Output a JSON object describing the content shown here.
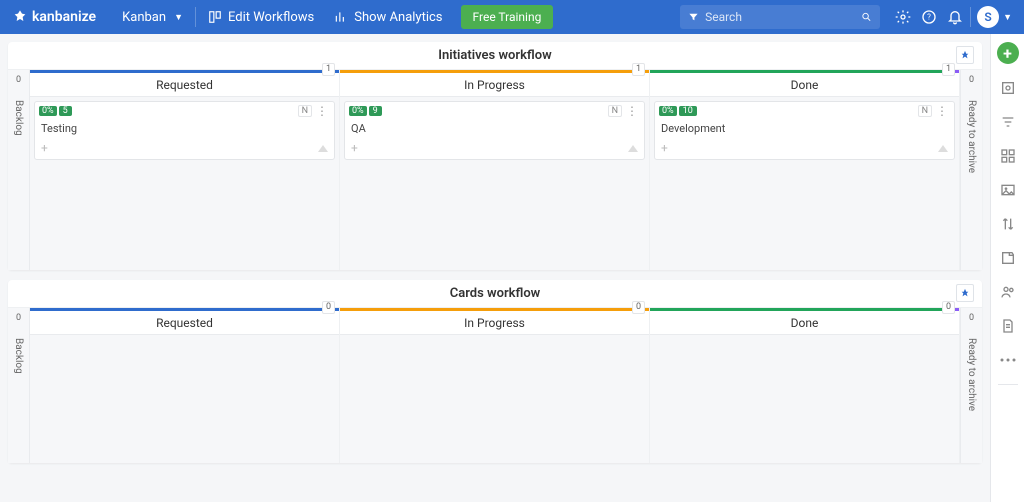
{
  "topbar": {
    "brand": "kanbanize",
    "board": "Kanban",
    "edit": "Edit Workflows",
    "analytics": "Show Analytics",
    "training": "Free Training",
    "search_placeholder": "Search",
    "avatar": "S"
  },
  "workflows": [
    {
      "title": "Initiatives workflow",
      "backlog": {
        "count": "0",
        "label": "Backlog"
      },
      "archive": {
        "count": "0",
        "label": "Ready to archive"
      },
      "columns": [
        {
          "name": "Requested",
          "color": "c-blue",
          "count": "1",
          "cards": [
            {
              "pct": "0%",
              "id": "5",
              "title": "Testing",
              "badge": "N"
            }
          ]
        },
        {
          "name": "In Progress",
          "color": "c-orange",
          "count": "1",
          "cards": [
            {
              "pct": "0%",
              "id": "9",
              "title": "QA",
              "badge": "N"
            }
          ]
        },
        {
          "name": "Done",
          "color": "c-green",
          "count": "1",
          "purple_end": true,
          "cards": [
            {
              "pct": "0%",
              "id": "10",
              "title": "Development",
              "badge": "N"
            }
          ]
        }
      ]
    },
    {
      "title": "Cards workflow",
      "backlog": {
        "count": "0",
        "label": "Backlog"
      },
      "archive": {
        "count": "0",
        "label": "Ready to archive"
      },
      "columns": [
        {
          "name": "Requested",
          "color": "c-blue",
          "count": "0",
          "cards": []
        },
        {
          "name": "In Progress",
          "color": "c-orange",
          "count": "0",
          "cards": []
        },
        {
          "name": "Done",
          "color": "c-green",
          "count": "0",
          "purple_end": true,
          "cards": []
        }
      ]
    }
  ],
  "icons": {
    "settings": "gear-icon",
    "help": "help-icon",
    "bell": "bell-icon",
    "filter": "filter-icon",
    "search": "search-icon"
  }
}
